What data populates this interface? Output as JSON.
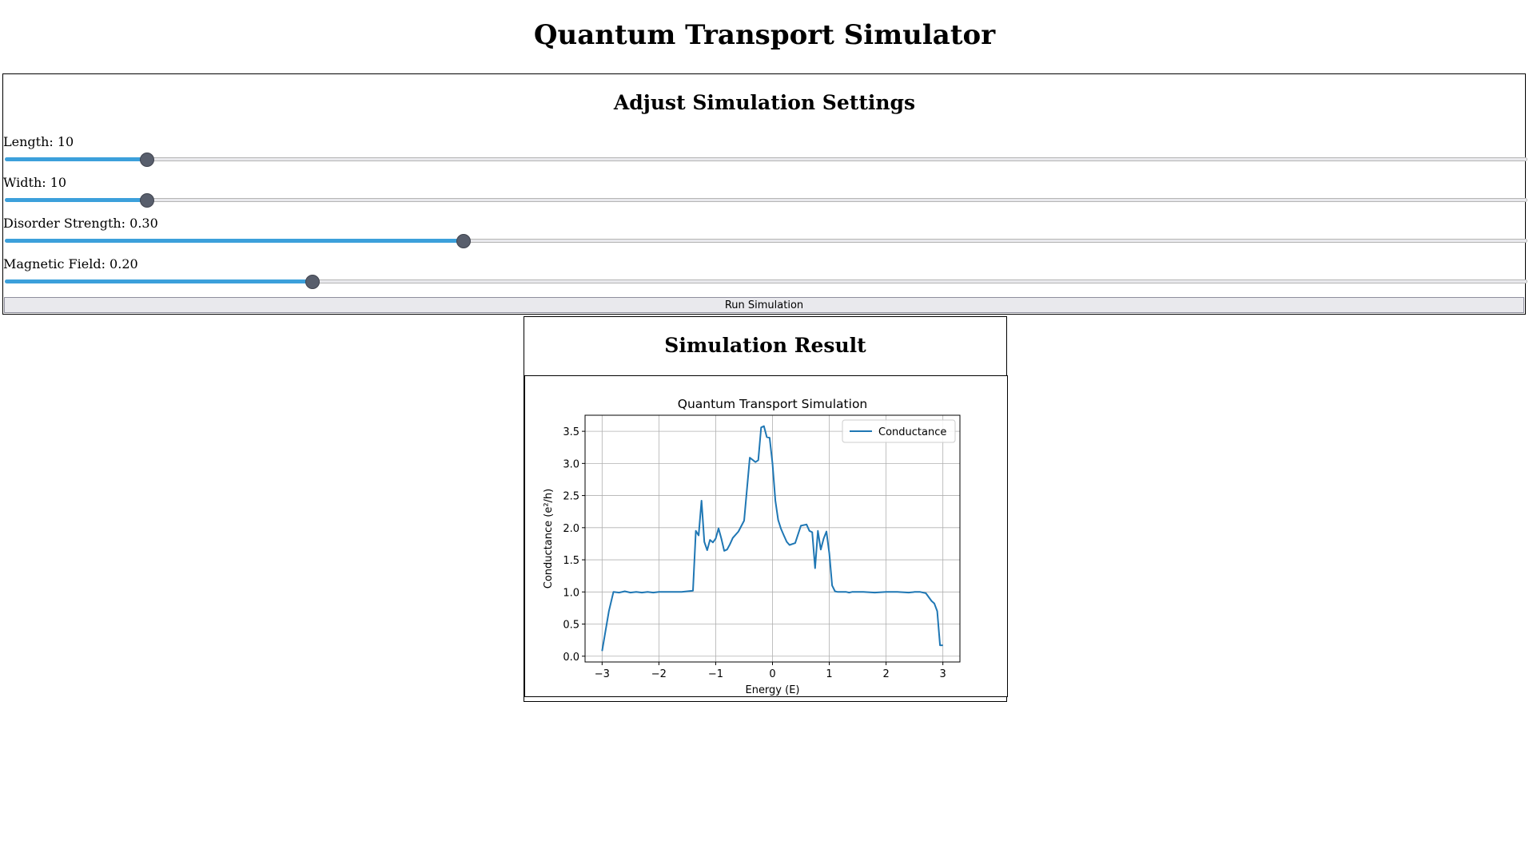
{
  "app": {
    "title": "Quantum Transport Simulator"
  },
  "settings": {
    "title": "Adjust Simulation Settings",
    "controls": [
      {
        "label": "Length: 10",
        "value": 10,
        "min": 1,
        "max": 100
      },
      {
        "label": "Width: 10",
        "value": 10,
        "min": 1,
        "max": 100
      },
      {
        "label": "Disorder Strength: 0.30",
        "value": 0.3,
        "min": 0,
        "max": 1
      },
      {
        "label": "Magnetic Field: 0.20",
        "value": 0.2,
        "min": 0,
        "max": 1
      }
    ],
    "run_label": "Run Simulation"
  },
  "result": {
    "title": "Simulation Result"
  },
  "colors": {
    "accent": "#3ca0db",
    "thumb": "#585e6c",
    "series": "#1f77b4"
  },
  "chart_data": {
    "type": "line",
    "title": "Quantum Transport Simulation",
    "xlabel": "Energy (E)",
    "ylabel": "Conductance (e²/h)",
    "xlim": [
      -3.3,
      3.3
    ],
    "ylim": [
      -0.09,
      3.75
    ],
    "xticks": [
      -3,
      -2,
      -1,
      0,
      1,
      2,
      3
    ],
    "xtick_labels": [
      "−3",
      "−2",
      "−1",
      "0",
      "1",
      "2",
      "3"
    ],
    "yticks": [
      0.0,
      0.5,
      1.0,
      1.5,
      2.0,
      2.5,
      3.0,
      3.5
    ],
    "ytick_labels": [
      "0.0",
      "0.5",
      "1.0",
      "1.5",
      "2.0",
      "2.5",
      "3.0",
      "3.5"
    ],
    "grid": true,
    "legend_position": "upper right",
    "series": [
      {
        "name": "Conductance",
        "x": [
          -3.0,
          -2.88,
          -2.8,
          -2.7,
          -2.6,
          -2.5,
          -2.4,
          -2.3,
          -2.2,
          -2.1,
          -2.0,
          -1.8,
          -1.6,
          -1.5,
          -1.4,
          -1.35,
          -1.3,
          -1.25,
          -1.2,
          -1.15,
          -1.1,
          -1.05,
          -1.0,
          -0.95,
          -0.9,
          -0.85,
          -0.8,
          -0.75,
          -0.7,
          -0.6,
          -0.5,
          -0.4,
          -0.3,
          -0.25,
          -0.2,
          -0.15,
          -0.1,
          -0.05,
          0.0,
          0.05,
          0.1,
          0.15,
          0.2,
          0.25,
          0.3,
          0.4,
          0.5,
          0.6,
          0.65,
          0.7,
          0.75,
          0.8,
          0.85,
          0.9,
          0.95,
          1.0,
          1.05,
          1.1,
          1.15,
          1.2,
          1.25,
          1.3,
          1.35,
          1.4,
          1.5,
          1.6,
          1.8,
          2.0,
          2.2,
          2.4,
          2.5,
          2.6,
          2.7,
          2.8,
          2.85,
          2.9,
          2.95,
          3.0
        ],
        "y": [
          0.08,
          0.7,
          1.0,
          0.99,
          1.01,
          0.99,
          1.0,
          0.99,
          1.0,
          0.99,
          1.0,
          1.0,
          1.0,
          1.01,
          1.02,
          1.95,
          1.88,
          2.42,
          1.78,
          1.65,
          1.81,
          1.77,
          1.83,
          1.99,
          1.83,
          1.64,
          1.66,
          1.74,
          1.84,
          1.94,
          2.11,
          3.09,
          3.02,
          3.05,
          3.56,
          3.58,
          3.41,
          3.4,
          3.0,
          2.42,
          2.12,
          1.98,
          1.88,
          1.78,
          1.73,
          1.76,
          2.03,
          2.05,
          1.95,
          1.93,
          1.37,
          1.95,
          1.66,
          1.83,
          1.94,
          1.6,
          1.1,
          1.01,
          1.0,
          1.0,
          1.0,
          1.0,
          0.99,
          1.0,
          1.0,
          1.0,
          0.99,
          1.0,
          1.0,
          0.99,
          1.0,
          1.0,
          0.98,
          0.86,
          0.82,
          0.7,
          0.17,
          0.17
        ]
      }
    ]
  }
}
